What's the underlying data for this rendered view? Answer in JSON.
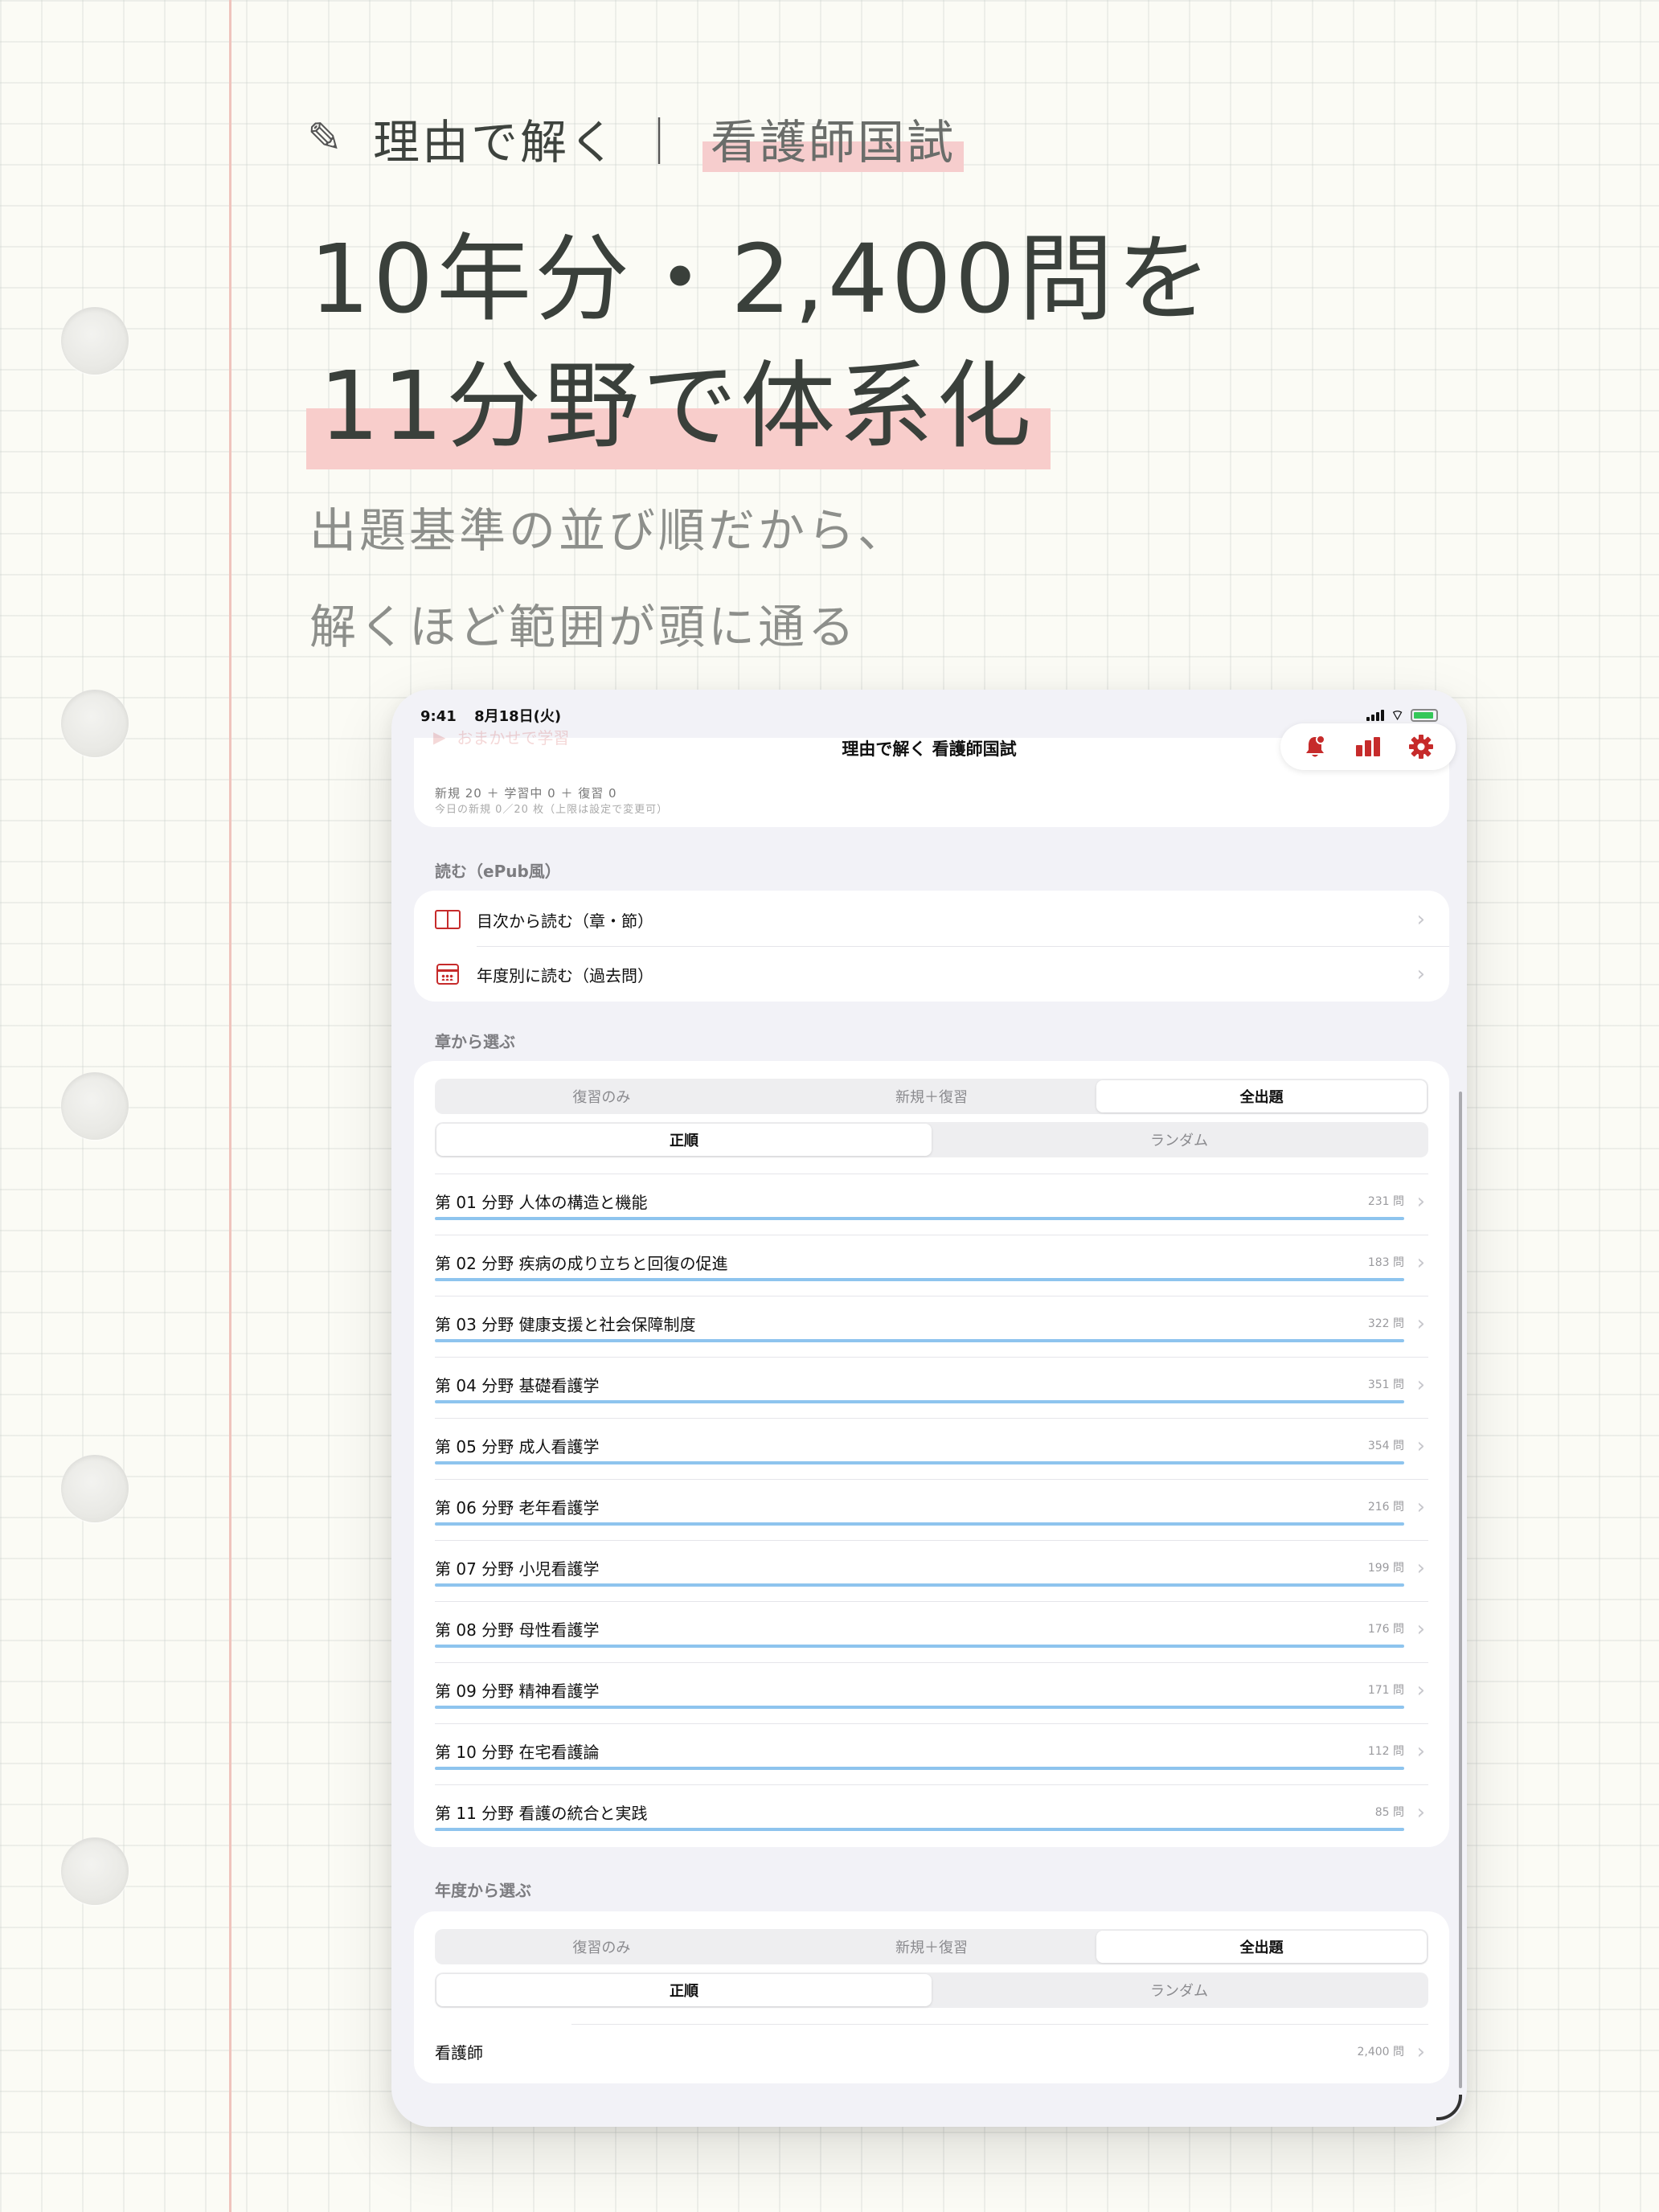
{
  "background": {
    "paper_color": "#fbfbf5",
    "margin_line_color": "#efc4bd",
    "highlight_color": "#f8cdcb",
    "ring_holes": 5
  },
  "promo": {
    "tagline_icon": "pencil-icon",
    "tagline_left": "理由で解く",
    "tagline_divider": "｜",
    "tagline_right": "看護師国試",
    "headline_line1": "10年分・2,400問を",
    "headline_line2": "11分野で体系化",
    "subcopy_line1": "出題基準の並び順だから、",
    "subcopy_line2": "解くほど範囲が頭に通る"
  },
  "status_bar": {
    "time": "9:41",
    "date": "8月18日(火)"
  },
  "nav": {
    "title": "理由で解く 看護師国試",
    "faded_action": "おまかせで学習",
    "toolbar_icons": [
      "bell-badge-icon",
      "chart-bar-icon",
      "gear-icon"
    ],
    "accent_color": "#c62b2b"
  },
  "top_card": {
    "stats_line": "新規 20 ＋ 学習中 0 ＋ 復習 0",
    "limit_line": "今日の新規 0／20 枚（上限は設定で変更可）"
  },
  "read_section": {
    "header": "読む（ePub風）",
    "items": [
      {
        "icon": "book-icon",
        "label": "目次から読む（章・節）"
      },
      {
        "icon": "calendar-icon",
        "label": "年度別に読む（過去問）"
      }
    ]
  },
  "chapter_section": {
    "header": "章から選ぶ",
    "mode_options": [
      "復習のみ",
      "新規＋復習",
      "全出題"
    ],
    "mode_selected": "全出題",
    "order_options": [
      "正順",
      "ランダム"
    ],
    "order_selected": "正順",
    "chapters": [
      {
        "label": "第 01 分野 人体の構造と機能",
        "count": "231 問",
        "progress": 1.0
      },
      {
        "label": "第 02 分野 疾病の成り立ちと回復の促進",
        "count": "183 問",
        "progress": 1.0
      },
      {
        "label": "第 03 分野 健康支援と社会保障制度",
        "count": "322 問",
        "progress": 1.0
      },
      {
        "label": "第 04 分野 基礎看護学",
        "count": "351 問",
        "progress": 1.0
      },
      {
        "label": "第 05 分野 成人看護学",
        "count": "354 問",
        "progress": 1.0
      },
      {
        "label": "第 06 分野 老年看護学",
        "count": "216 問",
        "progress": 1.0
      },
      {
        "label": "第 07 分野 小児看護学",
        "count": "199 問",
        "progress": 1.0
      },
      {
        "label": "第 08 分野 母性看護学",
        "count": "176 問",
        "progress": 1.0
      },
      {
        "label": "第 09 分野 精神看護学",
        "count": "171 問",
        "progress": 1.0
      },
      {
        "label": "第 10 分野 在宅看護論",
        "count": "112 問",
        "progress": 1.0
      },
      {
        "label": "第 11 分野 看護の統合と実践",
        "count": "85 問",
        "progress": 1.0
      }
    ]
  },
  "year_section": {
    "header": "年度から選ぶ",
    "mode_options": [
      "復習のみ",
      "新規＋復習",
      "全出題"
    ],
    "mode_selected": "全出題",
    "order_options": [
      "正順",
      "ランダム"
    ],
    "order_selected": "正順",
    "items": [
      {
        "label": "看護師",
        "count": "2,400 問"
      }
    ]
  }
}
